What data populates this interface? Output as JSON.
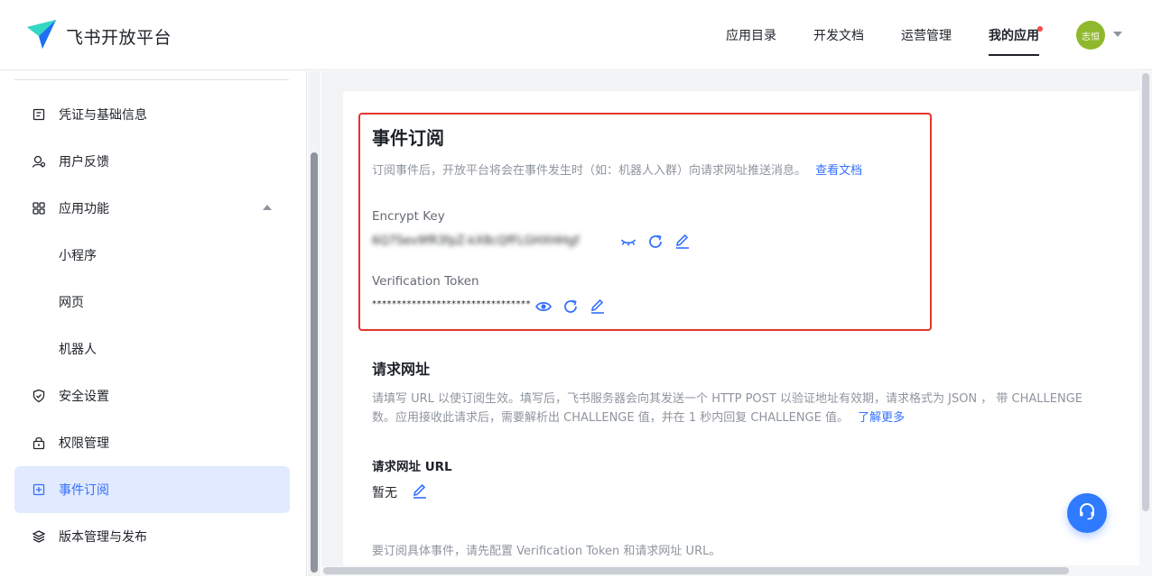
{
  "header": {
    "brand": "飞书开放平台",
    "nav": [
      "应用目录",
      "开发文档",
      "运营管理",
      "我的应用"
    ],
    "avatar_text": "志恒"
  },
  "sidebar": {
    "items": [
      {
        "label": "凭证与基础信息",
        "icon": "credential-icon"
      },
      {
        "label": "用户反馈",
        "icon": "user-feedback-icon"
      },
      {
        "label": "应用功能",
        "icon": "grid-icon"
      },
      {
        "label": "小程序"
      },
      {
        "label": "网页"
      },
      {
        "label": "机器人"
      },
      {
        "label": "安全设置",
        "icon": "shield-icon"
      },
      {
        "label": "权限管理",
        "icon": "lock-icon"
      },
      {
        "label": "事件订阅",
        "icon": "event-subscribe-icon"
      },
      {
        "label": "版本管理与发布",
        "icon": "layers-icon"
      }
    ]
  },
  "event_sub": {
    "title": "事件订阅",
    "desc": "订阅事件后，开放平台将会在事件发生时（如：机器人入群）向请求网址推送消息。",
    "doc_link": "查看文档",
    "encrypt_label": "Encrypt Key",
    "encrypt_value": "6Q7Sev9fR3fpZ-kX8cQfFLGHXHHgf",
    "token_label": "Verification Token",
    "token_value": "********************************"
  },
  "request_url": {
    "title": "请求网址",
    "desc_line1": "请填写 URL 以使订阅生效。填写后，飞书服务器会向其发送一个 HTTP POST 以验证地址有效期，请求格式为 JSON ， 带 CHALLENGE",
    "desc_line2": "数。应用接收此请求后，需要解析出 CHALLENGE 值，并在 1 秒内回复 CHALLENGE 值。",
    "learn_more": "了解更多",
    "url_label": "请求网址 URL",
    "url_value": "暂无"
  },
  "footer_note": "要订阅具体事件，请先配置 Verification Token 和请求网址 URL。",
  "colors": {
    "accent": "#3370ff",
    "highlight_border": "#e5352b",
    "active_bg": "#e1eaff",
    "notify_dot": "#f54a45"
  }
}
